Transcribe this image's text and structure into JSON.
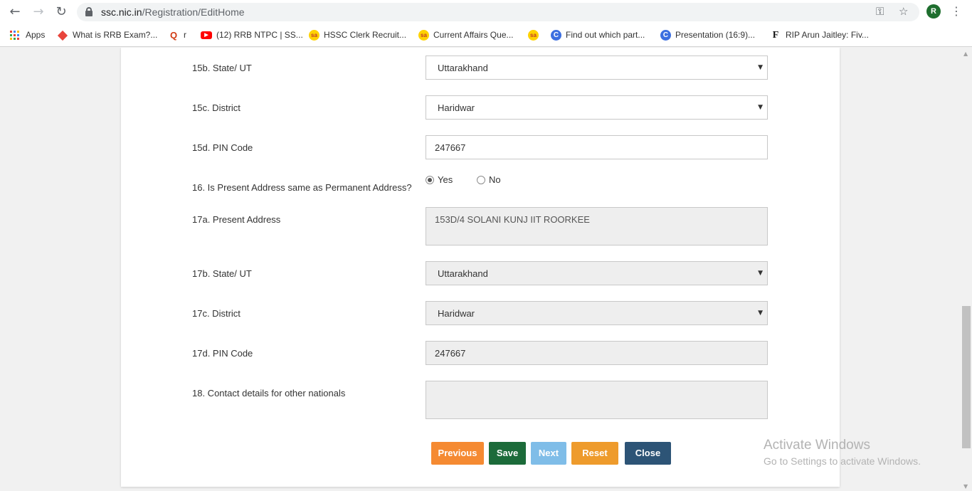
{
  "browser": {
    "url_host": "ssc.nic.in",
    "url_path": "/Registration/EditHome",
    "avatar_letter": "R",
    "icons": [
      "back-arrow-icon",
      "forward-arrow-icon",
      "reload-icon",
      "lock-icon",
      "key-icon",
      "star-icon",
      "kebab-menu-icon"
    ]
  },
  "bookmarks": [
    {
      "label": "Apps",
      "icon": "apps-grid-icon"
    },
    {
      "label": "What is RRB Exam?...",
      "icon": "diamond-icon"
    },
    {
      "label": "r",
      "icon": "q-icon"
    },
    {
      "label": "(12) RRB NTPC | SS...",
      "icon": "youtube-icon"
    },
    {
      "label": "HSSC Clerk Recruit...",
      "icon": "sa-icon"
    },
    {
      "label": "Current Affairs Que...",
      "icon": "sa-icon"
    },
    {
      "label": "",
      "icon": "sa-icon"
    },
    {
      "label": "Find out which part...",
      "icon": "canva-icon"
    },
    {
      "label": "Presentation (16:9)...",
      "icon": "canva-icon"
    },
    {
      "label": "RIP Arun Jaitley: Fiv...",
      "icon": "f-icon"
    }
  ],
  "form": {
    "state15b": {
      "label": "15b. State/ UT",
      "value": "Uttarakhand"
    },
    "district15c": {
      "label": "15c. District",
      "value": "Haridwar"
    },
    "pin15d": {
      "label": "15d. PIN Code",
      "value": "247667"
    },
    "same_address": {
      "label": "16. Is Present Address same as Permanent Address?",
      "yes": "Yes",
      "no": "No",
      "selected": "Yes"
    },
    "address17a": {
      "label": "17a. Present Address",
      "value": "153D/4 SOLANI KUNJ IIT ROORKEE"
    },
    "state17b": {
      "label": "17b. State/ UT",
      "value": "Uttarakhand"
    },
    "district17c": {
      "label": "17c. District",
      "value": "Haridwar"
    },
    "pin17d": {
      "label": "17d. PIN Code",
      "value": "247667"
    },
    "contact18": {
      "label": "18. Contact details for other nationals",
      "value": ""
    }
  },
  "buttons": {
    "previous": "Previous",
    "save": "Save",
    "next": "Next",
    "reset": "Reset",
    "close": "Close"
  },
  "colors": {
    "previous": "#f58a32",
    "save": "#1c6b3a",
    "next": "#7fbde8",
    "reset": "#ee9b2c",
    "close": "#2d5476"
  },
  "watermark": {
    "line1": "Activate Windows",
    "line2": "Go to Settings to activate Windows."
  }
}
